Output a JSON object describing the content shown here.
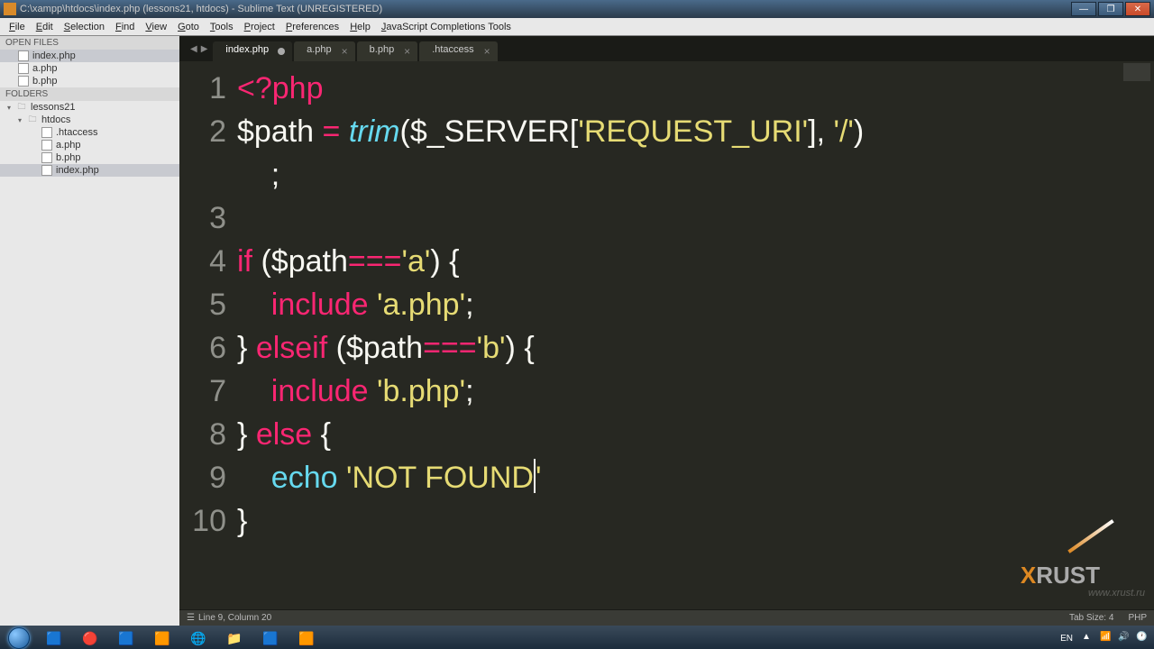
{
  "titlebar": {
    "path": "C:\\xampp\\htdocs\\index.php",
    "context": "(lessons21, htdocs)",
    "app": "Sublime Text",
    "registration": "(UNREGISTERED)"
  },
  "menu": [
    "File",
    "Edit",
    "Selection",
    "Find",
    "View",
    "Goto",
    "Tools",
    "Project",
    "Preferences",
    "Help",
    "JavaScript Completions Tools"
  ],
  "sidebar": {
    "open_files_header": "OPEN FILES",
    "open_files": [
      {
        "name": "index.php",
        "active": true
      },
      {
        "name": "a.php",
        "active": false
      },
      {
        "name": "b.php",
        "active": false
      }
    ],
    "folders_header": "FOLDERS",
    "tree": [
      {
        "depth": 0,
        "icon": "folder",
        "expand": "▾",
        "name": "lessons21"
      },
      {
        "depth": 1,
        "icon": "folder",
        "expand": "▾",
        "name": "htdocs"
      },
      {
        "depth": 2,
        "icon": "file",
        "name": ".htaccess"
      },
      {
        "depth": 2,
        "icon": "file",
        "name": "a.php"
      },
      {
        "depth": 2,
        "icon": "file",
        "name": "b.php"
      },
      {
        "depth": 2,
        "icon": "file",
        "name": "index.php",
        "active": true
      }
    ]
  },
  "tabs": [
    {
      "label": "index.php",
      "active": true,
      "dirty": true
    },
    {
      "label": "a.php",
      "active": false,
      "dirty": false
    },
    {
      "label": "b.php",
      "active": false,
      "dirty": false
    },
    {
      "label": ".htaccess",
      "active": false,
      "dirty": false
    }
  ],
  "code": {
    "lines": [
      [
        {
          "t": "<?php",
          "c": "kw"
        }
      ],
      [
        {
          "t": "$path",
          "c": "var"
        },
        {
          "t": " ",
          "c": "punct"
        },
        {
          "t": "=",
          "c": "op"
        },
        {
          "t": " ",
          "c": "punct"
        },
        {
          "t": "trim",
          "c": "fn"
        },
        {
          "t": "(",
          "c": "punct"
        },
        {
          "t": "$_SERVER",
          "c": "var"
        },
        {
          "t": "[",
          "c": "punct"
        },
        {
          "t": "'REQUEST_URI'",
          "c": "str"
        },
        {
          "t": "], ",
          "c": "punct"
        },
        {
          "t": "'/'",
          "c": "str"
        },
        {
          "t": ")",
          "c": "punct"
        }
      ],
      [
        {
          "t": "    ;",
          "c": "punct"
        }
      ],
      [],
      [
        {
          "t": "if",
          "c": "kw"
        },
        {
          "t": " (",
          "c": "punct"
        },
        {
          "t": "$path",
          "c": "var"
        },
        {
          "t": "===",
          "c": "op"
        },
        {
          "t": "'a'",
          "c": "str"
        },
        {
          "t": ") {",
          "c": "punct"
        }
      ],
      [
        {
          "t": "    ",
          "c": "punct"
        },
        {
          "t": "include",
          "c": "kw"
        },
        {
          "t": " ",
          "c": "punct"
        },
        {
          "t": "'a.php'",
          "c": "str"
        },
        {
          "t": ";",
          "c": "punct"
        }
      ],
      [
        {
          "t": "} ",
          "c": "punct"
        },
        {
          "t": "elseif",
          "c": "kw"
        },
        {
          "t": " (",
          "c": "punct"
        },
        {
          "t": "$path",
          "c": "var"
        },
        {
          "t": "===",
          "c": "op"
        },
        {
          "t": "'b'",
          "c": "str"
        },
        {
          "t": ") {",
          "c": "punct"
        }
      ],
      [
        {
          "t": "    ",
          "c": "punct"
        },
        {
          "t": "include",
          "c": "kw"
        },
        {
          "t": " ",
          "c": "punct"
        },
        {
          "t": "'b.php'",
          "c": "str"
        },
        {
          "t": ";",
          "c": "punct"
        }
      ],
      [
        {
          "t": "} ",
          "c": "punct"
        },
        {
          "t": "else",
          "c": "kw"
        },
        {
          "t": " {",
          "c": "punct"
        }
      ],
      [
        {
          "t": "    ",
          "c": "punct"
        },
        {
          "t": "echo",
          "c": "echo"
        },
        {
          "t": " ",
          "c": "punct"
        },
        {
          "t": "'NOT FOUND",
          "c": "str"
        },
        {
          "t": "",
          "c": "cursor"
        },
        {
          "t": "'",
          "c": "str"
        }
      ],
      [
        {
          "t": "}",
          "c": "punct"
        }
      ]
    ],
    "display_lines": 10
  },
  "status": {
    "position": "Line 9, Column 20",
    "tab_size": "Tab Size: 4",
    "syntax": "PHP"
  },
  "taskbar": {
    "icons": [
      "skype",
      "opera",
      "ps",
      "st",
      "chrome",
      "explorer",
      "wmp",
      "ppt"
    ],
    "lang": "EN"
  },
  "watermark": {
    "site": "www.xrust.ru",
    "brand_a": "X",
    "brand_b": "RUST"
  }
}
